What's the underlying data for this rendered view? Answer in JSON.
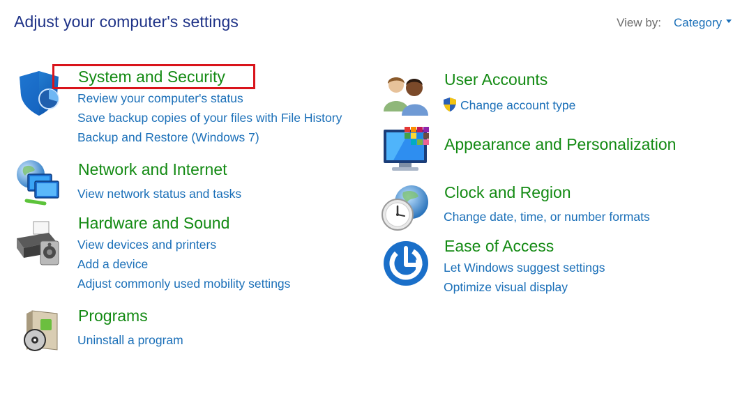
{
  "header": {
    "title": "Adjust your computer's settings",
    "view_by_label": "View by:",
    "view_by_value": "Category"
  },
  "categories": {
    "system_security": {
      "title": "System and Security",
      "icon": "shield-icon",
      "links": [
        "Review your computer's status",
        "Save backup copies of your files with File History",
        "Backup and Restore (Windows 7)"
      ]
    },
    "network_internet": {
      "title": "Network and Internet",
      "icon": "network-globe-icon",
      "links": [
        "View network status and tasks"
      ]
    },
    "hardware_sound": {
      "title": "Hardware and Sound",
      "icon": "printer-speaker-icon",
      "links": [
        "View devices and printers",
        "Add a device",
        "Adjust commonly used mobility settings"
      ]
    },
    "programs": {
      "title": "Programs",
      "icon": "programs-disc-icon",
      "links": [
        "Uninstall a program"
      ]
    },
    "user_accounts": {
      "title": "User Accounts",
      "icon": "users-icon",
      "links": [
        "Change account type"
      ]
    },
    "appearance": {
      "title": "Appearance and Personalization",
      "icon": "monitor-palette-icon",
      "links": []
    },
    "clock_region": {
      "title": "Clock and Region",
      "icon": "clock-globe-icon",
      "links": [
        "Change date, time, or number formats"
      ]
    },
    "ease_of_access": {
      "title": "Ease of Access",
      "icon": "ease-of-access-icon",
      "links": [
        "Let Windows suggest settings",
        "Optimize visual display"
      ]
    }
  },
  "colors": {
    "title": "#1e3287",
    "category_title": "#138a13",
    "link": "#1a6fb8",
    "highlight": "#d9141b"
  }
}
